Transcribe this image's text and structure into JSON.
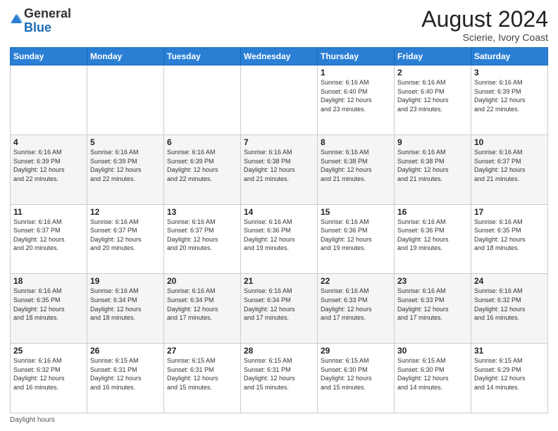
{
  "header": {
    "logo_general": "General",
    "logo_blue": "Blue",
    "month_year": "August 2024",
    "location": "Scierie, Ivory Coast"
  },
  "footer": {
    "note": "Daylight hours"
  },
  "weekdays": [
    "Sunday",
    "Monday",
    "Tuesday",
    "Wednesday",
    "Thursday",
    "Friday",
    "Saturday"
  ],
  "weeks": [
    [
      {
        "day": "",
        "info": ""
      },
      {
        "day": "",
        "info": ""
      },
      {
        "day": "",
        "info": ""
      },
      {
        "day": "",
        "info": ""
      },
      {
        "day": "1",
        "info": "Sunrise: 6:16 AM\nSunset: 6:40 PM\nDaylight: 12 hours\nand 23 minutes."
      },
      {
        "day": "2",
        "info": "Sunrise: 6:16 AM\nSunset: 6:40 PM\nDaylight: 12 hours\nand 23 minutes."
      },
      {
        "day": "3",
        "info": "Sunrise: 6:16 AM\nSunset: 6:39 PM\nDaylight: 12 hours\nand 22 minutes."
      }
    ],
    [
      {
        "day": "4",
        "info": "Sunrise: 6:16 AM\nSunset: 6:39 PM\nDaylight: 12 hours\nand 22 minutes."
      },
      {
        "day": "5",
        "info": "Sunrise: 6:16 AM\nSunset: 6:39 PM\nDaylight: 12 hours\nand 22 minutes."
      },
      {
        "day": "6",
        "info": "Sunrise: 6:16 AM\nSunset: 6:39 PM\nDaylight: 12 hours\nand 22 minutes."
      },
      {
        "day": "7",
        "info": "Sunrise: 6:16 AM\nSunset: 6:38 PM\nDaylight: 12 hours\nand 21 minutes."
      },
      {
        "day": "8",
        "info": "Sunrise: 6:16 AM\nSunset: 6:38 PM\nDaylight: 12 hours\nand 21 minutes."
      },
      {
        "day": "9",
        "info": "Sunrise: 6:16 AM\nSunset: 6:38 PM\nDaylight: 12 hours\nand 21 minutes."
      },
      {
        "day": "10",
        "info": "Sunrise: 6:16 AM\nSunset: 6:37 PM\nDaylight: 12 hours\nand 21 minutes."
      }
    ],
    [
      {
        "day": "11",
        "info": "Sunrise: 6:16 AM\nSunset: 6:37 PM\nDaylight: 12 hours\nand 20 minutes."
      },
      {
        "day": "12",
        "info": "Sunrise: 6:16 AM\nSunset: 6:37 PM\nDaylight: 12 hours\nand 20 minutes."
      },
      {
        "day": "13",
        "info": "Sunrise: 6:16 AM\nSunset: 6:37 PM\nDaylight: 12 hours\nand 20 minutes."
      },
      {
        "day": "14",
        "info": "Sunrise: 6:16 AM\nSunset: 6:36 PM\nDaylight: 12 hours\nand 19 minutes."
      },
      {
        "day": "15",
        "info": "Sunrise: 6:16 AM\nSunset: 6:36 PM\nDaylight: 12 hours\nand 19 minutes."
      },
      {
        "day": "16",
        "info": "Sunrise: 6:16 AM\nSunset: 6:36 PM\nDaylight: 12 hours\nand 19 minutes."
      },
      {
        "day": "17",
        "info": "Sunrise: 6:16 AM\nSunset: 6:35 PM\nDaylight: 12 hours\nand 18 minutes."
      }
    ],
    [
      {
        "day": "18",
        "info": "Sunrise: 6:16 AM\nSunset: 6:35 PM\nDaylight: 12 hours\nand 18 minutes."
      },
      {
        "day": "19",
        "info": "Sunrise: 6:16 AM\nSunset: 6:34 PM\nDaylight: 12 hours\nand 18 minutes."
      },
      {
        "day": "20",
        "info": "Sunrise: 6:16 AM\nSunset: 6:34 PM\nDaylight: 12 hours\nand 17 minutes."
      },
      {
        "day": "21",
        "info": "Sunrise: 6:16 AM\nSunset: 6:34 PM\nDaylight: 12 hours\nand 17 minutes."
      },
      {
        "day": "22",
        "info": "Sunrise: 6:16 AM\nSunset: 6:33 PM\nDaylight: 12 hours\nand 17 minutes."
      },
      {
        "day": "23",
        "info": "Sunrise: 6:16 AM\nSunset: 6:33 PM\nDaylight: 12 hours\nand 17 minutes."
      },
      {
        "day": "24",
        "info": "Sunrise: 6:16 AM\nSunset: 6:32 PM\nDaylight: 12 hours\nand 16 minutes."
      }
    ],
    [
      {
        "day": "25",
        "info": "Sunrise: 6:16 AM\nSunset: 6:32 PM\nDaylight: 12 hours\nand 16 minutes."
      },
      {
        "day": "26",
        "info": "Sunrise: 6:15 AM\nSunset: 6:31 PM\nDaylight: 12 hours\nand 16 minutes."
      },
      {
        "day": "27",
        "info": "Sunrise: 6:15 AM\nSunset: 6:31 PM\nDaylight: 12 hours\nand 15 minutes."
      },
      {
        "day": "28",
        "info": "Sunrise: 6:15 AM\nSunset: 6:31 PM\nDaylight: 12 hours\nand 15 minutes."
      },
      {
        "day": "29",
        "info": "Sunrise: 6:15 AM\nSunset: 6:30 PM\nDaylight: 12 hours\nand 15 minutes."
      },
      {
        "day": "30",
        "info": "Sunrise: 6:15 AM\nSunset: 6:30 PM\nDaylight: 12 hours\nand 14 minutes."
      },
      {
        "day": "31",
        "info": "Sunrise: 6:15 AM\nSunset: 6:29 PM\nDaylight: 12 hours\nand 14 minutes."
      }
    ]
  ]
}
